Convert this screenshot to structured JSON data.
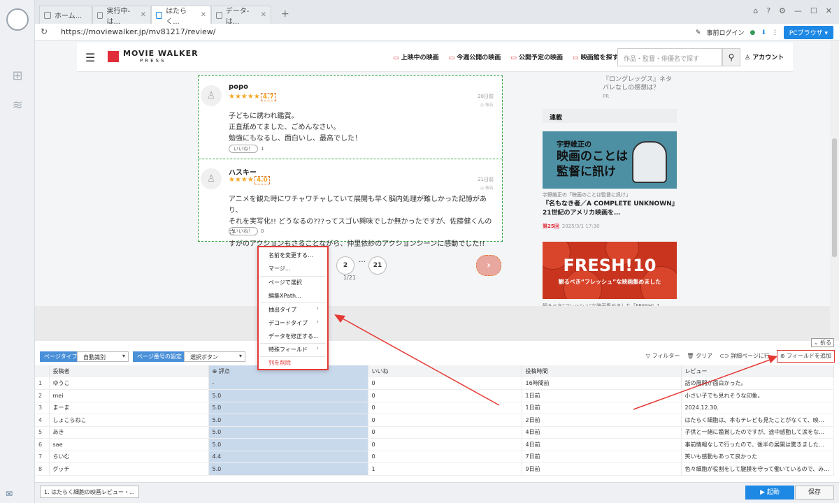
{
  "browser": {
    "tabs": [
      {
        "label": "ホーム..."
      },
      {
        "label": "実行中-は..."
      },
      {
        "label": "はたらく..."
      },
      {
        "label": "データ-は..."
      }
    ],
    "url": "https://moviewalker.jp/mv81217/review/",
    "login_label": "事前ログイン",
    "pc_browser_label": "PCブラウザ"
  },
  "site": {
    "brand": "MOVIE WALKER",
    "brand_sub": "PRESS",
    "nav": [
      "上映中の映画",
      "今週公開の映画",
      "公開予定の映画",
      "映画館を探す"
    ],
    "search_placeholder": "作品・監督・俳優名で探す",
    "account_label": "アカウント"
  },
  "reviews": [
    {
      "name": "popo",
      "stars": "★★★★★",
      "score": "4.7",
      "date": "20日前",
      "report": "◎ 報告",
      "lines": [
        "子どもに誘われ鑑賞。",
        "正直舐めてました、ごめんなさい。",
        "勉強にもなるし、面白いし、最高でした！"
      ],
      "like_label": "いいね！",
      "like_count": "1"
    },
    {
      "name": "ハスキー",
      "stars": "★★★★",
      "score": "4.0",
      "date": "21日前",
      "report": "◎ 報告",
      "lines": [
        "アニメを観た時にワチャワチャしていて展開も早く脳内処理が難しかった記憶があり、",
        "それを実写化!! どうなるの???ってスゴい興味でしか無かったですが、佐藤健くんのさ",
        "すがのアクションもさることながら、仲里依紗のアクションシーンに感動でした!!"
      ],
      "like_label": "いいね！",
      "like_count": "0"
    }
  ],
  "pager": {
    "pages": [
      "1",
      "2",
      "21"
    ],
    "dots": "…",
    "count": "1/21",
    "next": "›"
  },
  "sidebar": {
    "pr_text": "『ロングレッグス』ネタバレなしの感想は？",
    "pr_label": "PR",
    "section_title": "連載",
    "article1": {
      "image_sub": "宇野維正の",
      "image_line1": "映画のことは",
      "image_line2": "監督に訊け",
      "caption": "宇野維正の「映画のことは監督に訊け」",
      "title": "『名もなき者／A COMPLETE UNKNOWN』21世紀のアメリカ映画を…",
      "episode": "第25回",
      "datetime": "2025/3/1 17:30"
    },
    "article2": {
      "image_title": "FRESH!10",
      "image_sub": "観るべき“フレッシュ”な映画集めました",
      "caption": "観るべき“フレッシュ”な映画集めました「FRESH！1…"
    }
  },
  "context_menu": {
    "items": [
      "名前を変更する...",
      "マージ...",
      "ページで選択",
      "編集XPath...",
      "抽出タイプ",
      "デコードタイプ",
      "データを修正する...",
      "特殊フィールド",
      "列を削除"
    ]
  },
  "toolbar": {
    "page_type_label": "ページタイプ",
    "page_type_value": "自動識別",
    "page_num_label": "ページ番号の設定",
    "page_num_value": "選択ボタン",
    "filter_label": "フィルター",
    "clear_label": "クリア",
    "detail_label": "詳細ページに行",
    "add_field_label": "フィールドを追加",
    "fold_label": "折る"
  },
  "table": {
    "headers": [
      "投稿者",
      "評点",
      "いいね",
      "投稿時間",
      "レビュー"
    ],
    "rows": [
      [
        "1",
        "ゆうこ",
        "-",
        "0",
        "16時間前",
        "話の展開が面白かった。"
      ],
      [
        "2",
        "mei",
        "5.0",
        "0",
        "1日前",
        "小さい子でも見れそうな印象。"
      ],
      [
        "3",
        "まーま",
        "5.0",
        "0",
        "1日前",
        "2024.12.30."
      ],
      [
        "4",
        "しょこらねこ",
        "5.0",
        "0",
        "2日前",
        "はたらく細胞は、本もテレビも見たことがなくて、映画の予..."
      ],
      [
        "5",
        "あき",
        "5.0",
        "0",
        "4日前",
        "子供と一緒に鑑賞したのですが、途中感動して涙をながし..."
      ],
      [
        "6",
        "sae",
        "5.0",
        "0",
        "4日前",
        "事前情報なしで行ったので、後半の展開は驚きました。テン..."
      ],
      [
        "7",
        "らいむ",
        "4.4",
        "0",
        "7日前",
        "笑いも感動もあって良かった"
      ],
      [
        "8",
        "グッチ",
        "5.0",
        "1",
        "9日前",
        "色々細胞が役割をして腱膜を守って働いているので、みんな..."
      ]
    ]
  },
  "footer": {
    "task_label": "1. はたらく細胞の映画レビュー・...",
    "start_label": "▶  起動",
    "save_label": "保存"
  }
}
